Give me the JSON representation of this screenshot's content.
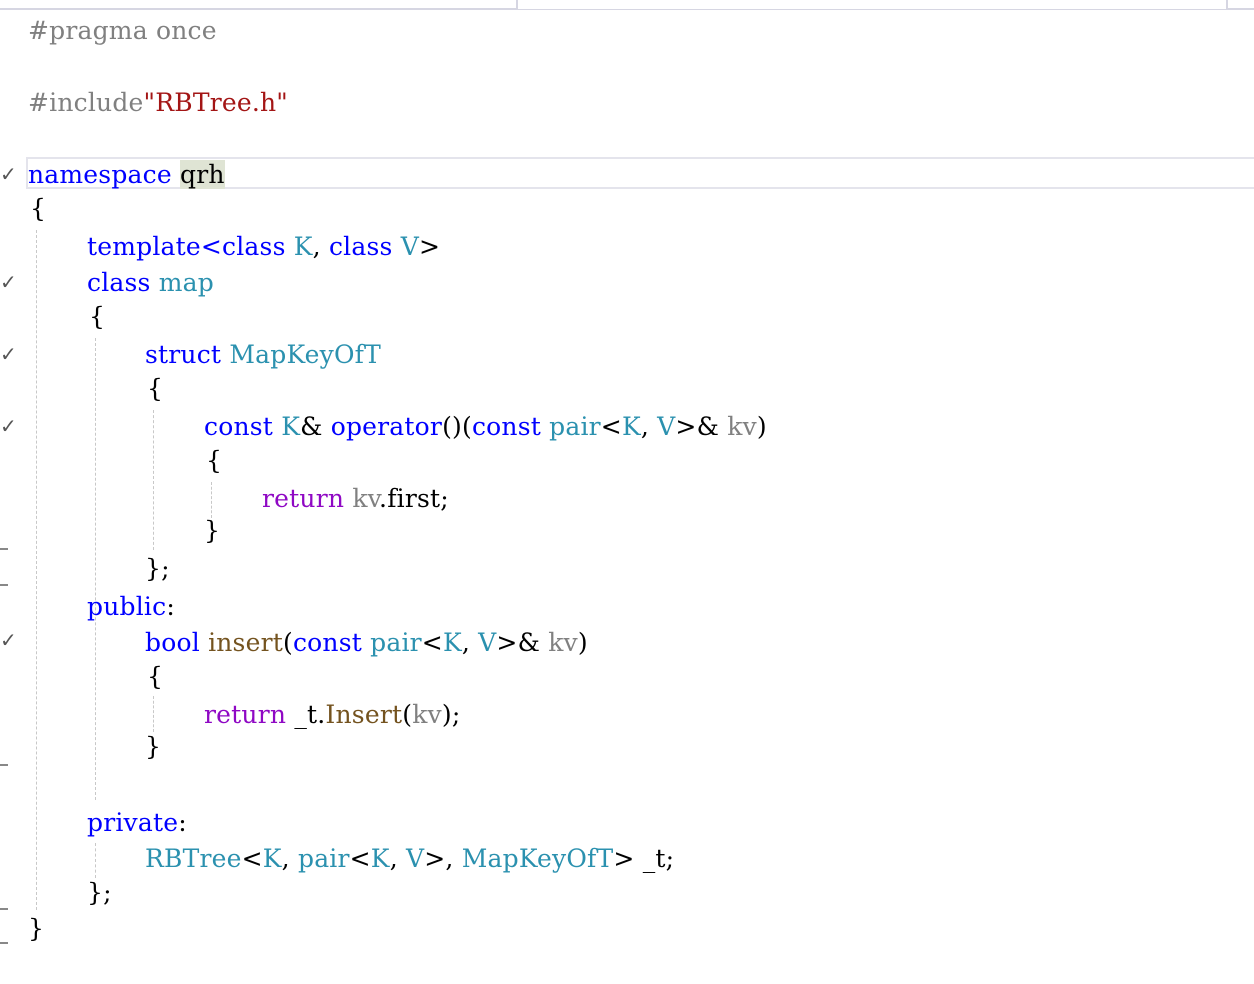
{
  "editor": {
    "tokens": {
      "pragma": "#pragma once",
      "include_directive": "#include",
      "include_file": "\"RBTree.h\"",
      "namespace_kw": "namespace",
      "namespace_name": "qrh",
      "brace_open": "{",
      "brace_close": "}",
      "brace_close_semi": "};",
      "template_kw": "template<class",
      "K": "K",
      "V": "V",
      "comma": ",",
      "class_kw": "class",
      "gt": ">",
      "map_name": "map",
      "struct_kw": "struct",
      "mapkeyoft": "MapKeyOfT",
      "const_kw": "const",
      "amp": "&",
      "operator_kw": "operator",
      "parens": "()",
      "lparen": "(",
      "rparen": ")",
      "pair": "pair",
      "lt": "<",
      "kv": "kv",
      "return_kw": "return",
      "dot": ".",
      "first": "first",
      "semi": ";",
      "public_kw": "public",
      "colon": ":",
      "bool_kw": "bool",
      "insert_fn": "insert",
      "member_t": "_t",
      "Insert_fn": "Insert",
      "private_kw": "private",
      "rbtree": "RBTree"
    }
  }
}
